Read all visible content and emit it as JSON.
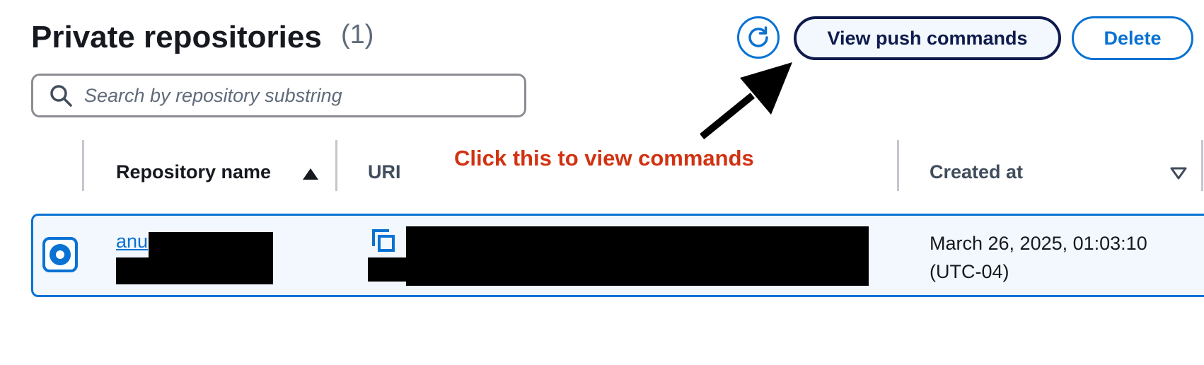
{
  "header": {
    "title": "Private repositories",
    "count": "(1)"
  },
  "toolbar": {
    "refresh_icon": "refresh-icon",
    "push_commands_label": "View push commands",
    "delete_label": "Delete"
  },
  "search": {
    "placeholder": "Search by repository substring",
    "value": "",
    "icon": "search-icon"
  },
  "annotation": {
    "text": "Click this to view commands",
    "color": "#d13212",
    "arrow_icon": "arrow-icon"
  },
  "table": {
    "columns": [
      {
        "label": "Repository name",
        "sort": "ascending"
      },
      {
        "label": "URI"
      },
      {
        "label": "Created at",
        "sort": "descending"
      }
    ],
    "rows": [
      {
        "selected": true,
        "repository_name": "anu",
        "uri": "",
        "created_at": [
          "March 26, 2025, 01:03:10",
          "(UTC-04)"
        ]
      }
    ]
  },
  "colors": {
    "accent": "#0972d3",
    "primary_button_border": "#0f1b4c",
    "selected_row_bg": "#f2f8fd",
    "text": "#16191f"
  }
}
